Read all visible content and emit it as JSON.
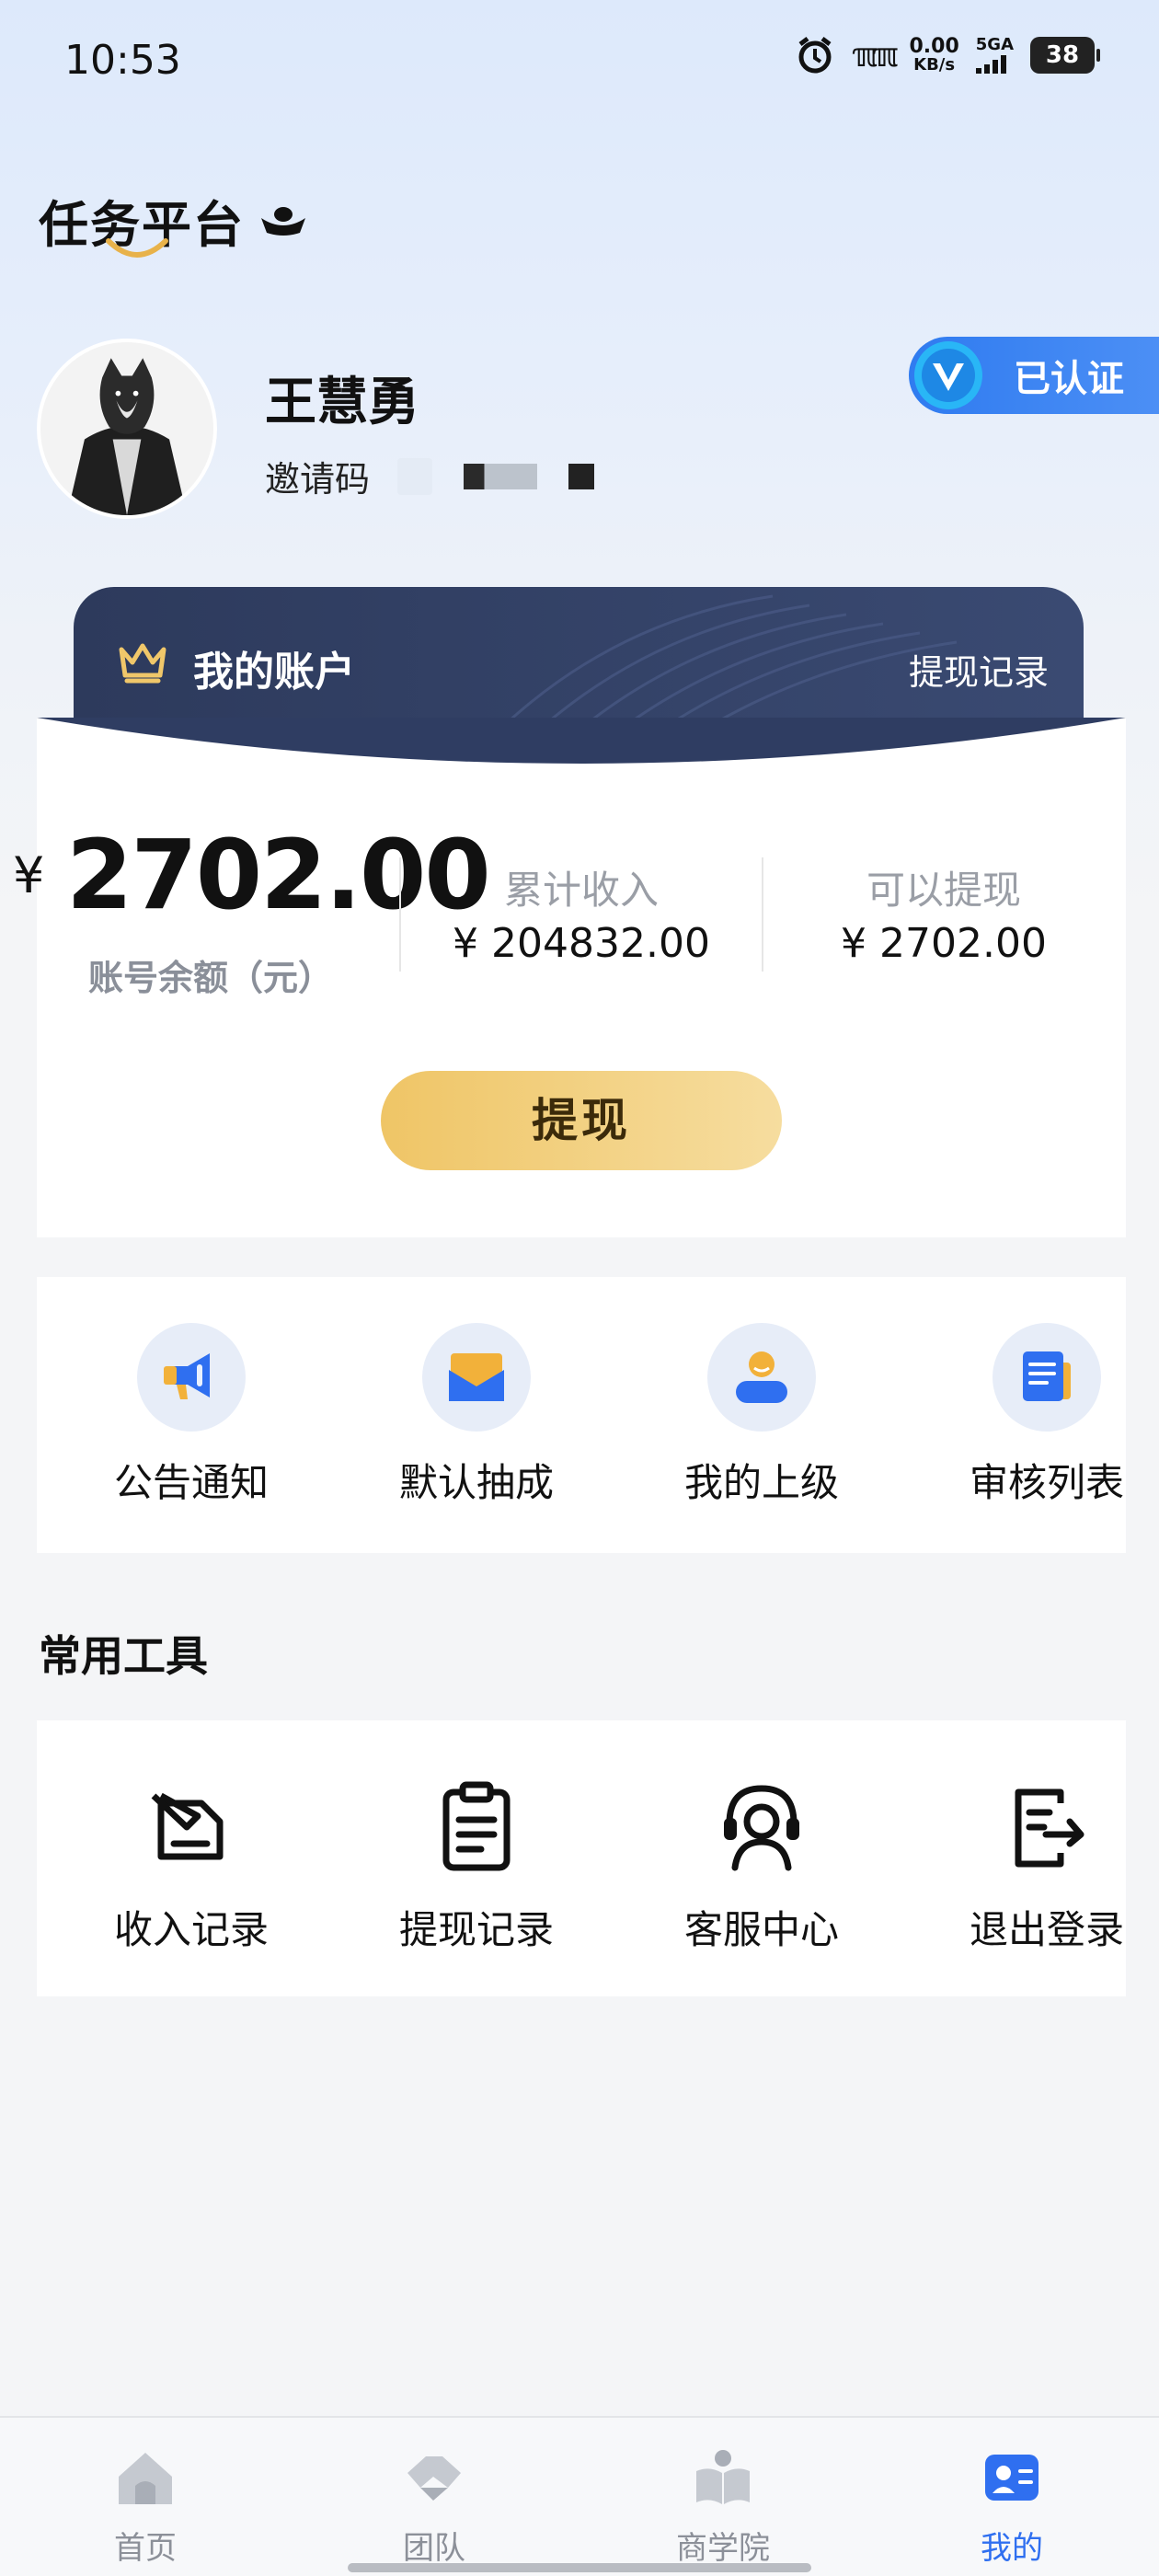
{
  "status_bar": {
    "time": "10:53",
    "net_speed_value": "0.00",
    "net_speed_unit": "KB/s",
    "network": "5GA",
    "battery": "38"
  },
  "brand": {
    "title": "任务平台"
  },
  "profile": {
    "name": "王慧勇",
    "invite_label": "邀请码",
    "verified_label": "已认证"
  },
  "account": {
    "title": "我的账户",
    "history_link": "提现记录",
    "currency": "¥",
    "balance": "2702.00",
    "balance_label": "账号余额（元）",
    "total_income_label": "累计收入",
    "total_income_value": "¥ 204832.00",
    "withdrawable_label": "可以提现",
    "withdrawable_value": "¥ 2702.00",
    "withdraw_button": "提现"
  },
  "quick_menu": [
    {
      "label": "公告通知",
      "icon": "megaphone-icon"
    },
    {
      "label": "默认抽成",
      "icon": "envelope-icon"
    },
    {
      "label": "我的上级",
      "icon": "person-icon"
    },
    {
      "label": "审核列表",
      "icon": "document-list-icon"
    }
  ],
  "tools": {
    "title": "常用工具",
    "items": [
      {
        "label": "收入记录",
        "icon": "income-record-icon"
      },
      {
        "label": "提现记录",
        "icon": "clipboard-icon"
      },
      {
        "label": "客服中心",
        "icon": "headset-icon"
      },
      {
        "label": "退出登录",
        "icon": "logout-icon"
      }
    ]
  },
  "tabbar": {
    "active": "我的",
    "items": [
      {
        "label": "首页",
        "icon": "home-icon"
      },
      {
        "label": "团队",
        "icon": "team-icon"
      },
      {
        "label": "商学院",
        "icon": "book-icon"
      },
      {
        "label": "我的",
        "icon": "profile-icon"
      }
    ]
  },
  "colors": {
    "accent": "#2f6ff0",
    "card_header": "#2d3a5c",
    "gold": "#efc566",
    "verified": "#2f7bf0"
  }
}
